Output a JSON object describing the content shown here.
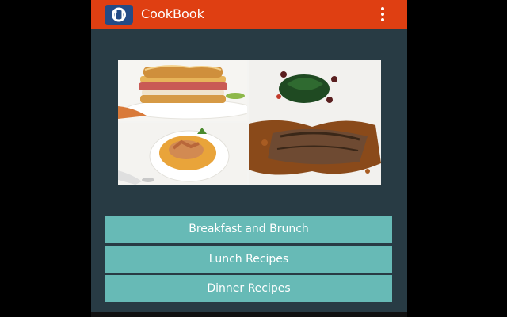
{
  "app": {
    "title": "CookBook",
    "icon": "cutlery-icon"
  },
  "toolbar": {
    "overflow_icon": "more-vert-icon"
  },
  "colors": {
    "app_bar": "#df3f12",
    "background": "#283b44",
    "button": "#67bab6",
    "app_icon_bg": "#234b86"
  },
  "menu": {
    "breakfast_label": "Breakfast and Brunch",
    "lunch_label": "Lunch Recipes",
    "dinner_label": "Dinner Recipes"
  }
}
